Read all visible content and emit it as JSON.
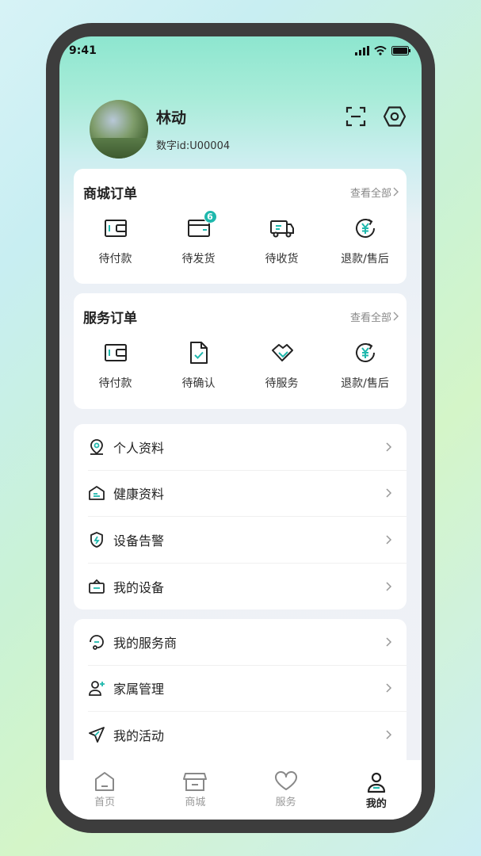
{
  "status": {
    "time": "9:41"
  },
  "profile": {
    "name": "林动",
    "id_text": "数字id:U00004"
  },
  "shop_orders": {
    "title": "商城订单",
    "see_all": "查看全部",
    "items": [
      {
        "label": "待付款",
        "icon": "wallet-icon"
      },
      {
        "label": "待发货",
        "icon": "box-icon",
        "badge": "6"
      },
      {
        "label": "待收货",
        "icon": "truck-icon"
      },
      {
        "label": "退款/售后",
        "icon": "refund-icon"
      }
    ]
  },
  "service_orders": {
    "title": "服务订单",
    "see_all": "查看全部",
    "items": [
      {
        "label": "待付款",
        "icon": "wallet-icon"
      },
      {
        "label": "待确认",
        "icon": "doc-check-icon"
      },
      {
        "label": "待服务",
        "icon": "handshake-icon"
      },
      {
        "label": "退款/售后",
        "icon": "refund-icon"
      }
    ]
  },
  "menu1": [
    {
      "label": "个人资料",
      "icon": "location-person-icon"
    },
    {
      "label": "健康资料",
      "icon": "health-icon"
    },
    {
      "label": "设备告警",
      "icon": "shield-alert-icon"
    },
    {
      "label": "我的设备",
      "icon": "device-bag-icon"
    }
  ],
  "menu2": [
    {
      "label": "我的服务商",
      "icon": "headset-icon"
    },
    {
      "label": "家属管理",
      "icon": "add-user-icon"
    },
    {
      "label": "我的活动",
      "icon": "send-icon"
    }
  ],
  "tabs": [
    {
      "label": "首页",
      "icon": "home-icon"
    },
    {
      "label": "商城",
      "icon": "store-icon"
    },
    {
      "label": "服务",
      "icon": "heart-icon"
    },
    {
      "label": "我的",
      "icon": "profile-icon",
      "active": true
    }
  ],
  "colors": {
    "accent": "#1fb8ad",
    "text": "#222222"
  }
}
